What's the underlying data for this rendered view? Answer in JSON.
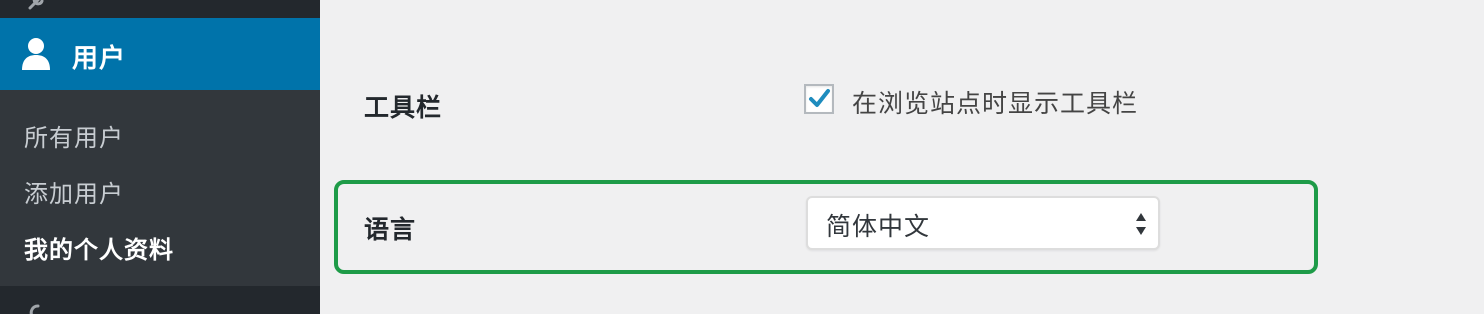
{
  "sidebar": {
    "top_partial_label": "工具",
    "current_menu": {
      "label": "用户",
      "icon": "user-icon"
    },
    "submenu": [
      {
        "label": "所有用户",
        "current": false
      },
      {
        "label": "添加用户",
        "current": false
      },
      {
        "label": "我的个人资料",
        "current": true
      }
    ],
    "bottom_partial_label": "工具",
    "colors": {
      "background": "#23282d",
      "current_bg": "#0073aa",
      "submenu_bg": "#32373c"
    }
  },
  "settings": {
    "toolbar": {
      "label": "工具栏",
      "checkbox_label": "在浏览站点时显示工具栏",
      "checked": true
    },
    "language": {
      "label": "语言",
      "selected": "简体中文"
    },
    "highlight_color": "#1e9b48"
  }
}
